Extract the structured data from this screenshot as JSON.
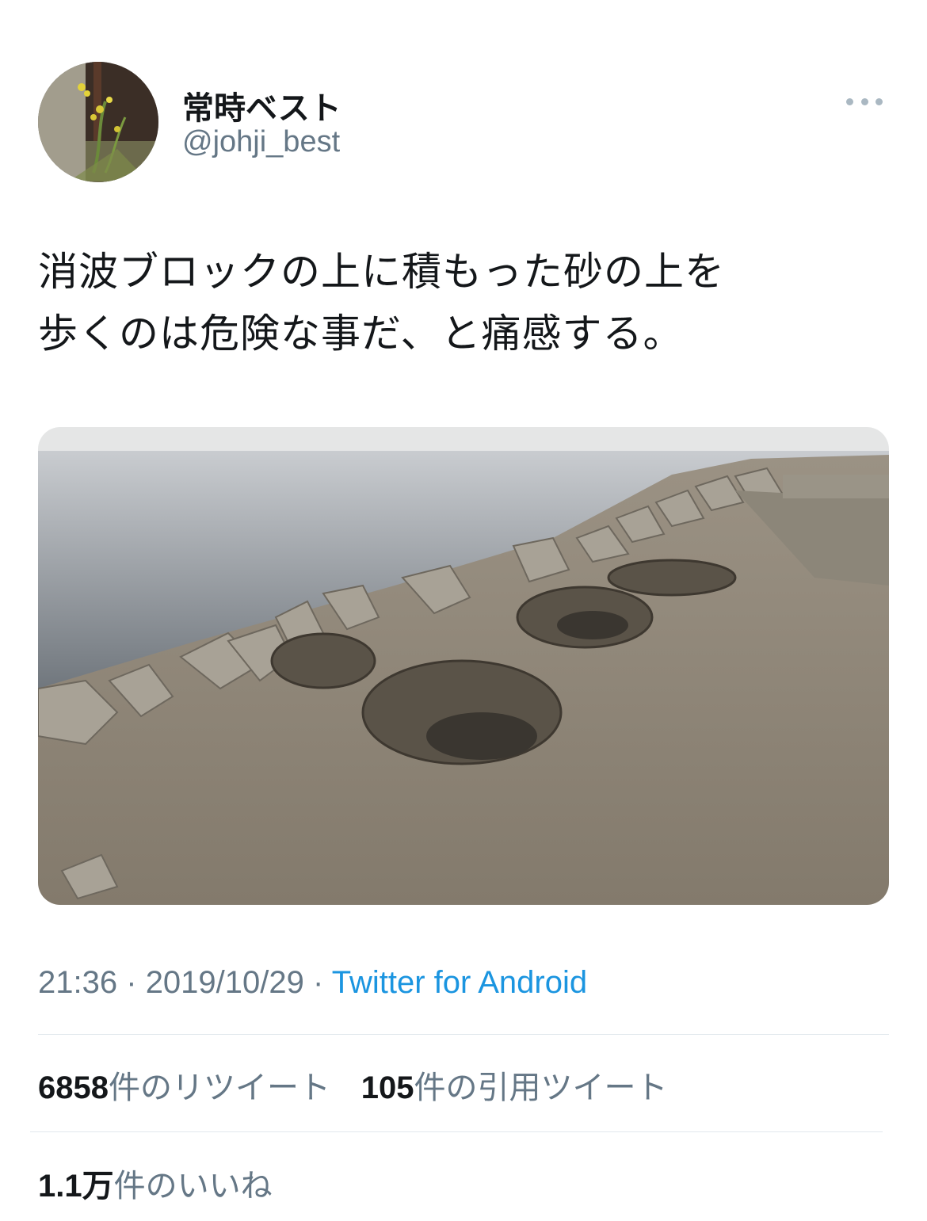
{
  "user": {
    "display_name": "常時ベスト",
    "handle": "@johji_best"
  },
  "tweet": {
    "text_lines": [
      "消波ブロックの上に積もった砂の上を",
      "歩くのは危険な事だ、と痛感する。"
    ],
    "time": "21:36",
    "separator": "·",
    "date": "2019/10/29",
    "source": "Twitter for Android"
  },
  "stats": {
    "retweets_count": "6858",
    "retweets_label": "件のリツイート",
    "quotes_count": "105",
    "quotes_label": "件の引用ツイート",
    "likes_count": "1.1万",
    "likes_label": "件のいいね"
  },
  "icons": {
    "more": "more-options-icon"
  },
  "colors": {
    "text": "#14171a",
    "secondary": "#657786",
    "link": "#1b95e0",
    "divider": "#e1e8ed"
  }
}
